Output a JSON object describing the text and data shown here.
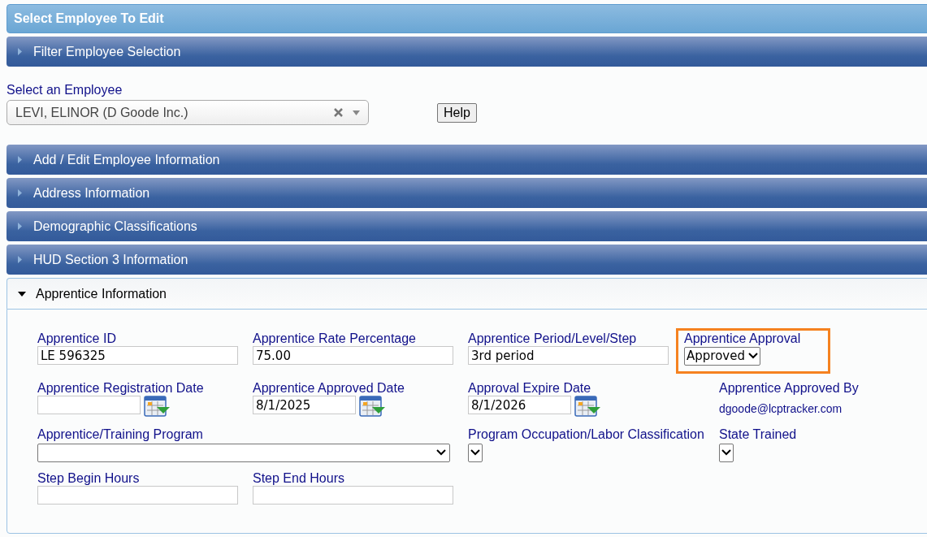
{
  "title": "Select Employee To Edit",
  "sections_before": [
    {
      "label": "Filter Employee Selection",
      "expanded": false
    }
  ],
  "employee_select": {
    "label": "Select an Employee",
    "value": "LEVI, ELINOR (D Goode Inc.)"
  },
  "help_button": "Help",
  "sections": [
    {
      "label": "Add / Edit Employee Information",
      "expanded": false
    },
    {
      "label": "Address Information",
      "expanded": false
    },
    {
      "label": "Demographic Classifications",
      "expanded": false
    },
    {
      "label": "HUD Section 3 Information",
      "expanded": false
    },
    {
      "label": "Apprentice Information",
      "expanded": true
    }
  ],
  "apprentice_rows": [
    [
      {
        "kind": "text",
        "label": "Apprentice ID",
        "value": "LE 596325"
      },
      {
        "kind": "text",
        "label": "Apprentice Rate Percentage",
        "value": "75.00"
      },
      {
        "kind": "text",
        "label": "Apprentice Period/Level/Step",
        "value": "3rd period"
      },
      {
        "kind": "select",
        "label": "Apprentice Approval",
        "value": "Approved",
        "highlighted": true
      }
    ],
    [
      {
        "kind": "date",
        "label": "Apprentice Registration Date"
      },
      {
        "kind": "date",
        "label": "Apprentice Approved Date",
        "value": "8/1/2025"
      },
      {
        "kind": "date",
        "label": "Approval Expire Date",
        "value": "8/1/2026"
      },
      {
        "kind": "static",
        "label": "Apprentice Approved By",
        "value": "dgoode@lcptracker.com"
      }
    ],
    [
      {
        "kind": "wide-select",
        "label": "Apprentice/Training Program"
      },
      {
        "kind": "select",
        "label": "Program Occupation/Labor Classification"
      },
      {
        "kind": "select",
        "label": "State Trained"
      }
    ],
    [
      {
        "kind": "text",
        "label": "Step Begin Hours"
      },
      {
        "kind": "text",
        "label": "Step End Hours"
      }
    ]
  ]
}
